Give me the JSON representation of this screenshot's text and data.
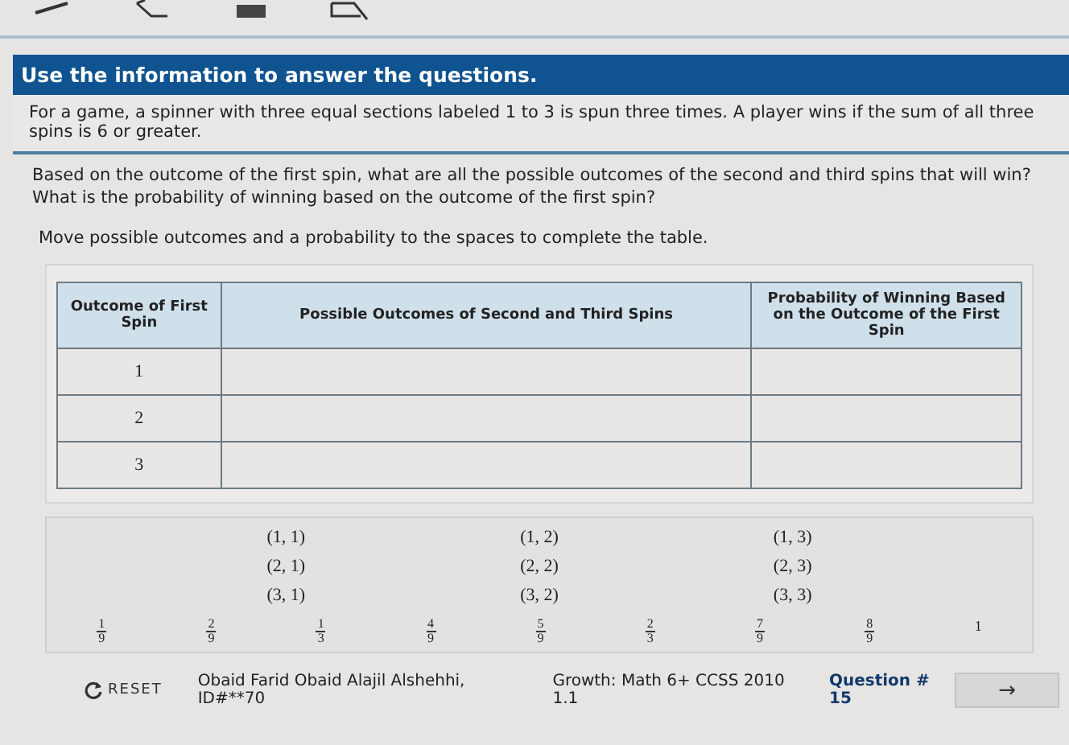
{
  "header": {
    "title": "Use the information to answer the questions."
  },
  "stem": {
    "scenario": "For a game, a spinner with three equal sections labeled 1 to 3 is spun three times. A player wins if the sum of all three spins is 6 or greater.",
    "question": "Based on the outcome of the first spin, what are all the possible outcomes of the second and third spins that will win? What is the probability of winning based on the outcome of the first spin?",
    "instruction": "Move possible outcomes and a probability to the spaces to complete the table."
  },
  "table": {
    "columns": [
      "Outcome of First Spin",
      "Possible Outcomes of Second and Third Spins",
      "Probability of Winning Based on the Outcome of the First Spin"
    ],
    "rows": [
      {
        "outcome": "1"
      },
      {
        "outcome": "2"
      },
      {
        "outcome": "3"
      }
    ]
  },
  "outcome_tiles": [
    "(1, 1)",
    "(1, 2)",
    "(1, 3)",
    "(2, 1)",
    "(2, 2)",
    "(2, 3)",
    "(3, 1)",
    "(3, 2)",
    "(3, 3)"
  ],
  "probability_tiles": [
    {
      "kind": "fraction",
      "numerator": "1",
      "denominator": "9"
    },
    {
      "kind": "fraction",
      "numerator": "2",
      "denominator": "9"
    },
    {
      "kind": "fraction",
      "numerator": "1",
      "denominator": "3"
    },
    {
      "kind": "fraction",
      "numerator": "4",
      "denominator": "9"
    },
    {
      "kind": "fraction",
      "numerator": "5",
      "denominator": "9"
    },
    {
      "kind": "fraction",
      "numerator": "2",
      "denominator": "3"
    },
    {
      "kind": "fraction",
      "numerator": "7",
      "denominator": "9"
    },
    {
      "kind": "fraction",
      "numerator": "8",
      "denominator": "9"
    },
    {
      "kind": "whole",
      "value": "1"
    }
  ],
  "footer": {
    "reset": "RESET",
    "student": "Obaid Farid Obaid Alajil Alshehhi, ID#**70",
    "test": "Growth: Math 6+ CCSS 2010 1.1",
    "question_number": "Question # 15",
    "next": "→"
  }
}
